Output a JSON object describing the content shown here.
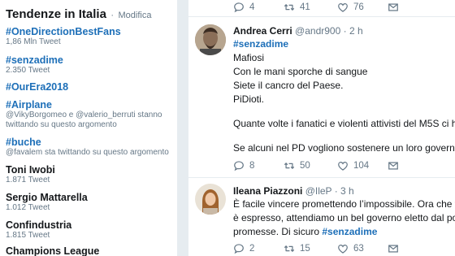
{
  "trends": {
    "title": "Tendenze in Italia",
    "separator": "·",
    "change_label": "Modifica",
    "items": [
      {
        "name": "#OneDirectionBestFans",
        "meta": "1,86 Mln Tweet"
      },
      {
        "name": "#senzadime",
        "meta": "2.350 Tweet"
      },
      {
        "name": "#OurEra2018",
        "meta": ""
      },
      {
        "name": "#Airplane",
        "meta": "@VikyBorgomeo e @valerio_berruti stanno",
        "meta2": "twittando su questo argomento"
      },
      {
        "name": "#buche",
        "meta": "@favalem sta twittando su questo argomento"
      },
      {
        "name": "Toni Iwobi",
        "meta": "1.871 Tweet"
      },
      {
        "name": "Sergio Mattarella",
        "meta": "1.012 Tweet"
      },
      {
        "name": "Confindustria",
        "meta": "1.815 Tweet"
      },
      {
        "name": "Champions League",
        "meta": ""
      }
    ]
  },
  "feed": {
    "top_actions": {
      "replies": "4",
      "retweets": "41",
      "likes": "76"
    },
    "tweets": [
      {
        "author": "Andrea Cerri",
        "handle": "@andr900",
        "separator": "·",
        "time": "2 h",
        "hashtag": "#senzadime",
        "lines": [
          "Mafiosi",
          "Con le mani sporche di sangue",
          "Siete il cancro del Paese.",
          "PiDioti."
        ],
        "line5": "Quante volte i fanatici e violenti attivisti del M5S ci hanno",
        "line6": "Se alcuni nel PD vogliono sostenere un loro governo lo facc",
        "replies": "8",
        "retweets": "50",
        "likes": "104"
      },
      {
        "author": "Ileana Piazzoni",
        "handle": "@IleP",
        "separator": "·",
        "time": "3 h",
        "line1": "È facile vincere promettendo l’impossibile. Ora che finalme",
        "line2": "è espresso, attendiamo un bel governo eletto dal popolo ch",
        "line3_text": "promesse. Di sicuro",
        "line3_tag": "#senzadime",
        "replies": "2",
        "retweets": "15",
        "likes": "63"
      }
    ]
  },
  "icons": {
    "reply": "reply-icon",
    "retweet": "retweet-icon",
    "like": "heart-icon",
    "message": "envelope-icon"
  },
  "colors": {
    "link": "#1d6fb8",
    "muted": "#657786",
    "background": "#e6ecf0"
  }
}
